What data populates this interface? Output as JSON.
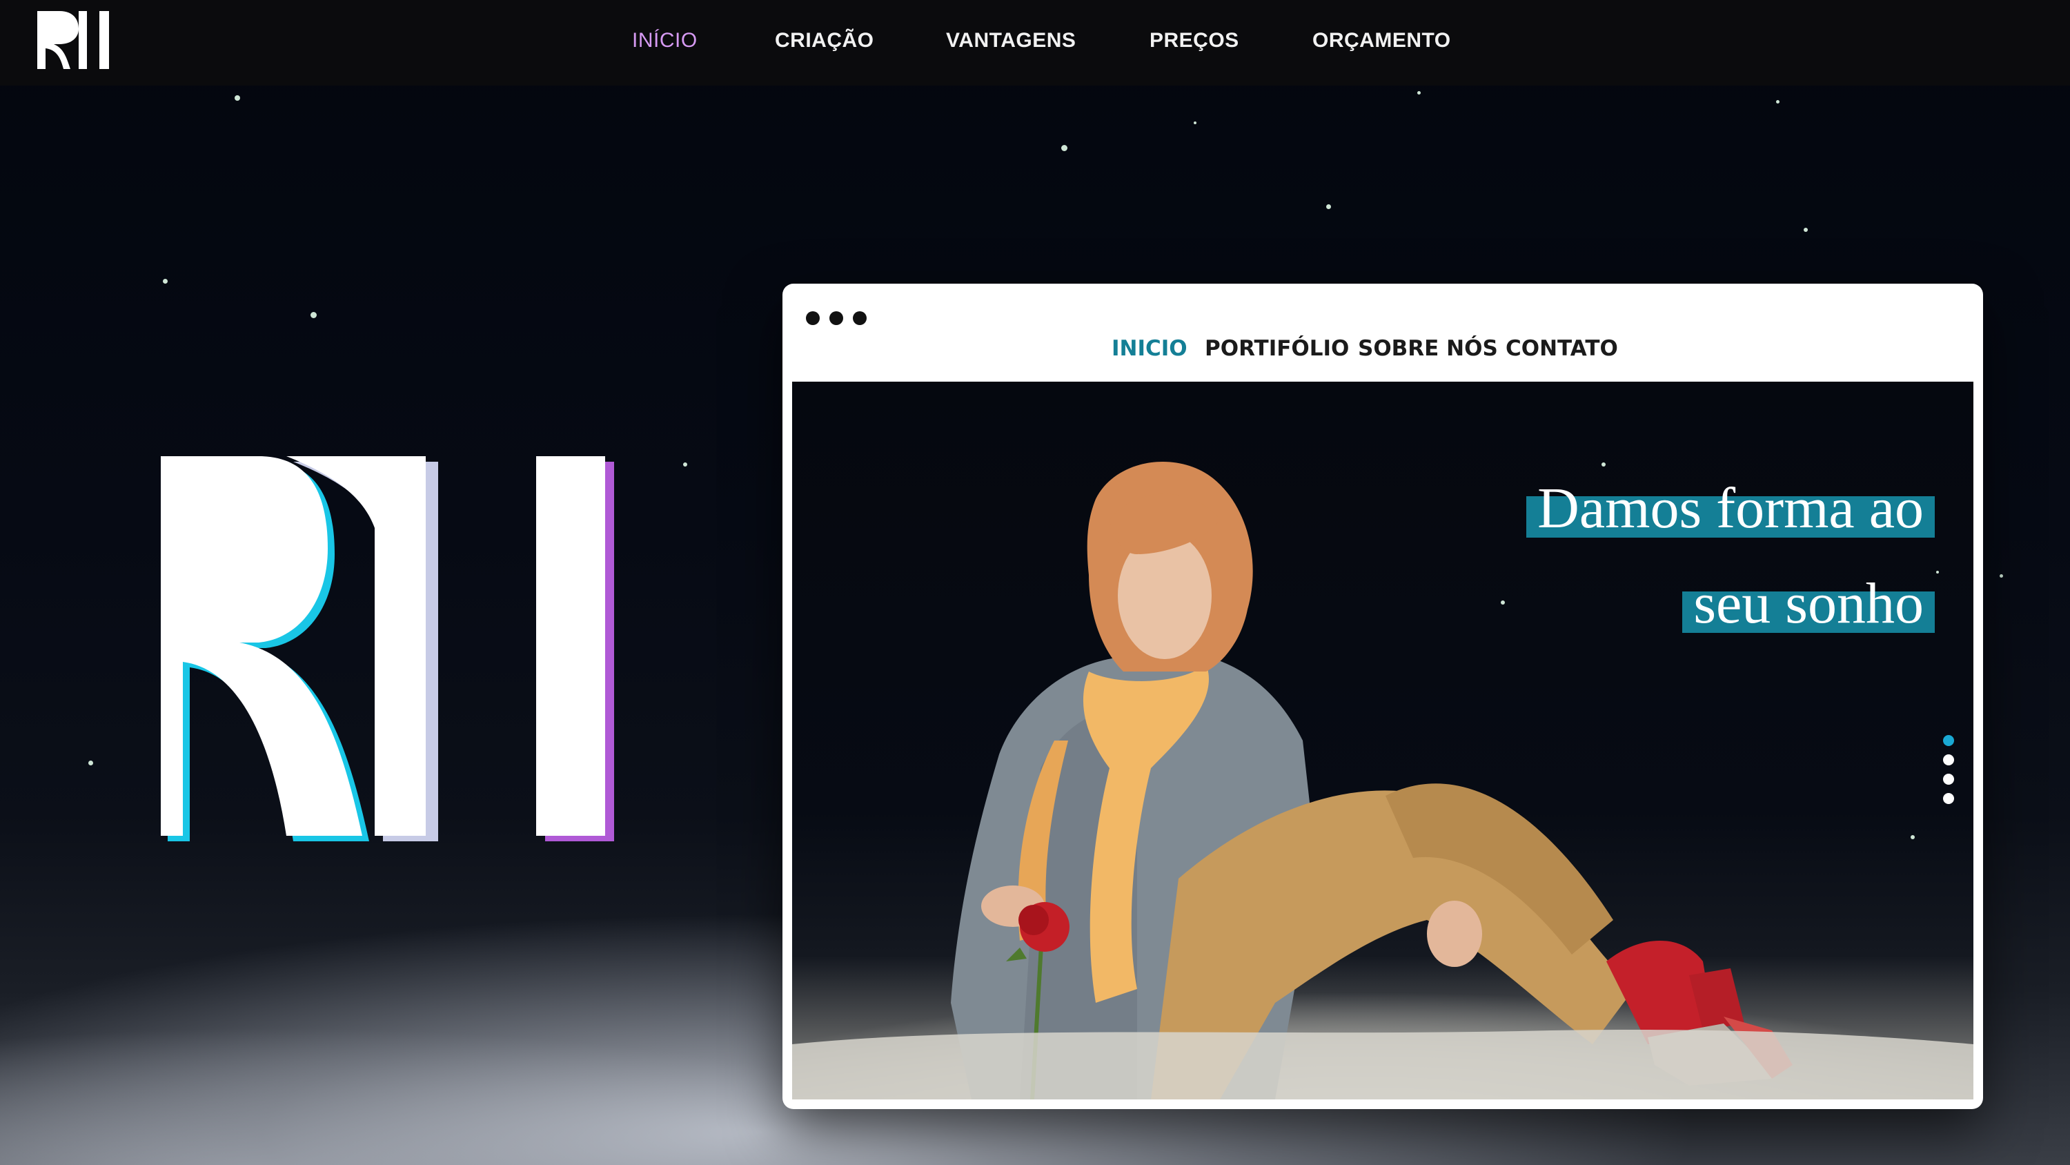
{
  "header": {
    "brand_logo": "RI",
    "nav": [
      {
        "label": "INÍCIO",
        "active": true
      },
      {
        "label": "CRIAÇÃO",
        "active": false
      },
      {
        "label": "VANTAGENS",
        "active": false
      },
      {
        "label": "PREÇOS",
        "active": false
      },
      {
        "label": "ORÇAMENTO",
        "active": false
      }
    ]
  },
  "hero": {
    "big_logo": "RI"
  },
  "mockup": {
    "window_dots": 3,
    "nav": [
      {
        "label": "INICIO",
        "active": true
      },
      {
        "label": "PORTIFÓLIO",
        "active": false
      },
      {
        "label": "SOBRE NÓS",
        "active": false
      },
      {
        "label": "CONTATO",
        "active": false
      }
    ],
    "headline_lines": [
      "Damos forma ao",
      "seu sonho"
    ],
    "slider_dots": 4,
    "slider_active_index": 0
  },
  "colors": {
    "nav_active": "#d69af2",
    "accent_teal": "#147f96",
    "slider_active": "#1aa9d4",
    "logo_shadow_cyan": "#19c6e6",
    "logo_shadow_purple": "#b05ad6"
  }
}
